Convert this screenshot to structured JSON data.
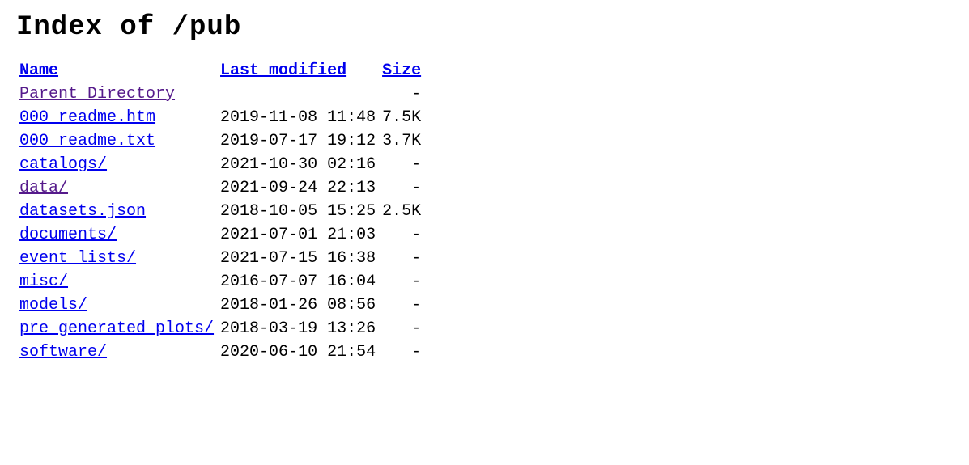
{
  "title": "Index of /pub",
  "headers": {
    "name": "Name",
    "modified": "Last modified",
    "size": "Size"
  },
  "parent": {
    "label": "Parent Directory",
    "size": "-"
  },
  "rows": [
    {
      "name": "000_readme.htm",
      "modified": "2019-11-08 11:48",
      "size": "7.5K",
      "visited": false
    },
    {
      "name": "000_readme.txt",
      "modified": "2019-07-17 19:12",
      "size": "3.7K",
      "visited": false
    },
    {
      "name": "catalogs/",
      "modified": "2021-10-30 02:16",
      "size": "-",
      "visited": false
    },
    {
      "name": "data/",
      "modified": "2021-09-24 22:13",
      "size": "-",
      "visited": true
    },
    {
      "name": "datasets.json",
      "modified": "2018-10-05 15:25",
      "size": "2.5K",
      "visited": false
    },
    {
      "name": "documents/",
      "modified": "2021-07-01 21:03",
      "size": "-",
      "visited": false
    },
    {
      "name": "event_lists/",
      "modified": "2021-07-15 16:38",
      "size": "-",
      "visited": false
    },
    {
      "name": "misc/",
      "modified": "2016-07-07 16:04",
      "size": "-",
      "visited": false
    },
    {
      "name": "models/",
      "modified": "2018-01-26 08:56",
      "size": "-",
      "visited": false
    },
    {
      "name": "pre_generated_plots/",
      "modified": "2018-03-19 13:26",
      "size": "-",
      "visited": false
    },
    {
      "name": "software/",
      "modified": "2020-06-10 21:54",
      "size": "-",
      "visited": false
    }
  ]
}
